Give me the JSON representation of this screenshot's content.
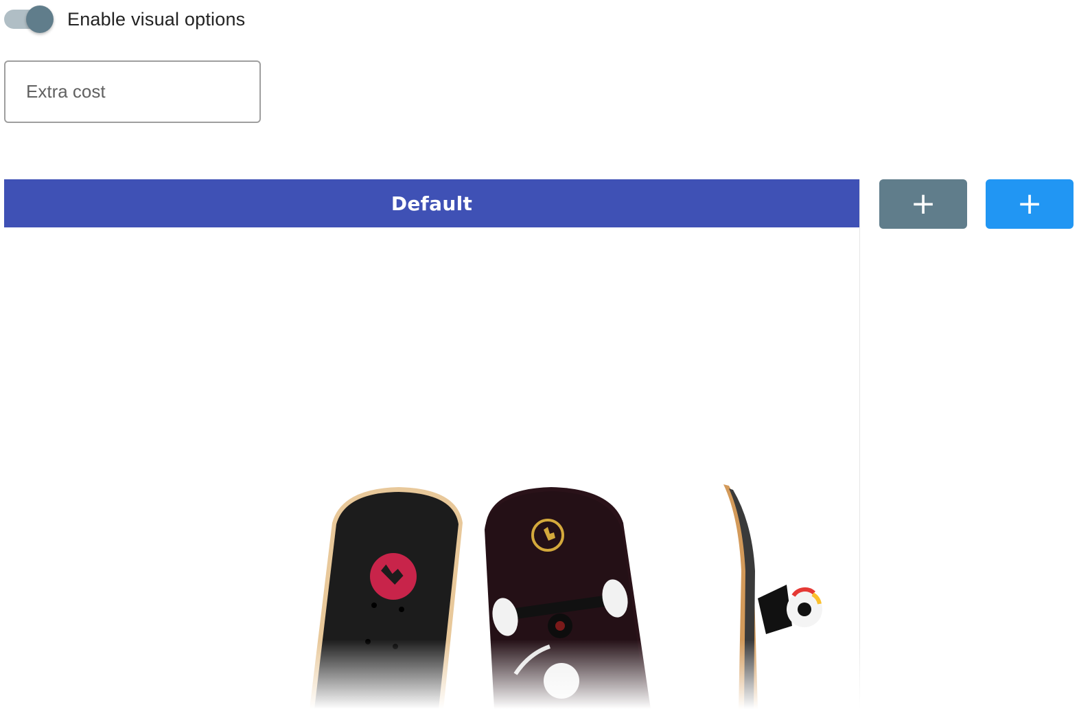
{
  "toggle": {
    "label": "Enable visual options",
    "checked": true
  },
  "extra_cost": {
    "placeholder": "Extra cost",
    "value": ""
  },
  "option": {
    "header": "Default",
    "image_alt": "skateboard-product-image"
  },
  "buttons": {
    "add_grey_label": "+",
    "add_blue_label": "+"
  },
  "colors": {
    "header_bg": "#3f51b5",
    "add_grey": "#607d8b",
    "add_blue": "#2196f3",
    "toggle_knob": "#607d8b",
    "toggle_track": "#b0bec5"
  }
}
